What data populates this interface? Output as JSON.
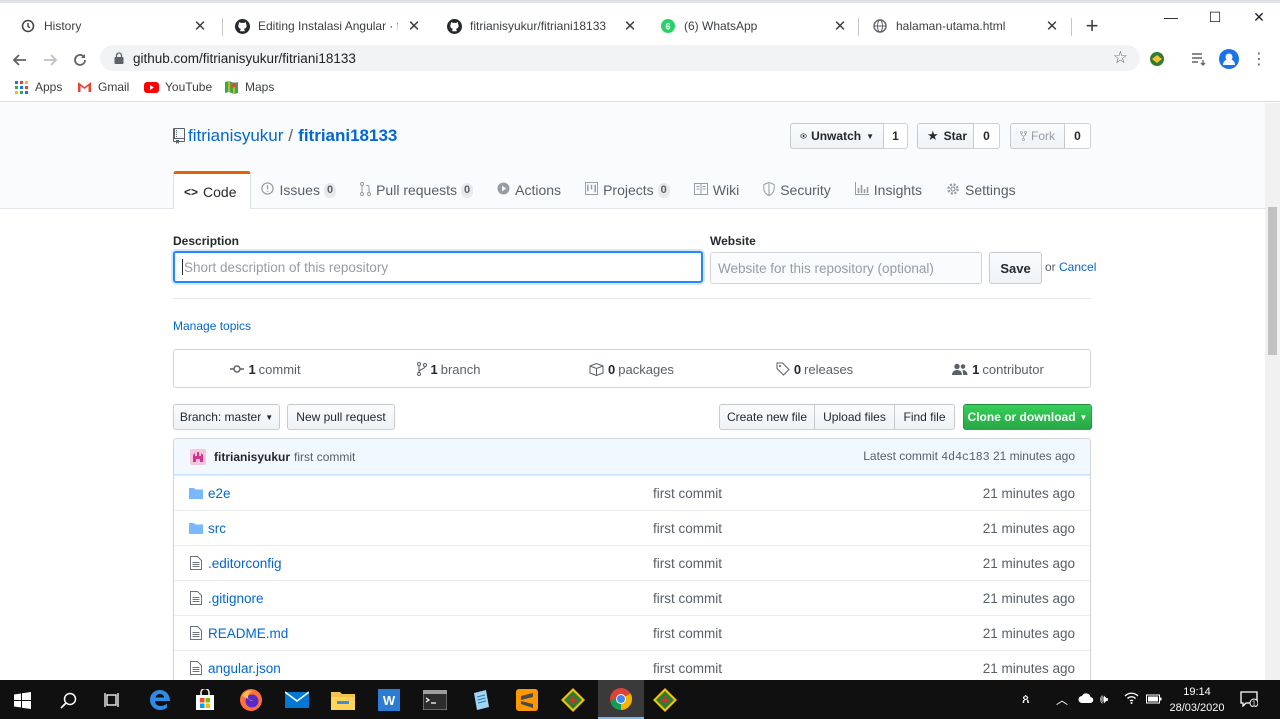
{
  "browser": {
    "tabs": [
      {
        "title": "History",
        "icon": "history-icon"
      },
      {
        "title": "Editing Instalasi Angular · fitria",
        "icon": "github-icon"
      },
      {
        "title": "fitrianisyukur/fitriani18133",
        "icon": "github-icon",
        "active": true
      },
      {
        "title": "(6) WhatsApp",
        "icon": "whatsapp-icon"
      },
      {
        "title": "halaman-utama.html",
        "icon": "globe-icon"
      }
    ],
    "url": "github.com/fitrianisyukur/fitriani18133",
    "bookmarks": [
      "Apps",
      "Gmail",
      "YouTube",
      "Maps"
    ]
  },
  "repo": {
    "owner": "fitrianisyukur",
    "separator": "/",
    "name": "fitriani18133",
    "watch_label": "Unwatch",
    "watch_count": "1",
    "star_label": "Star",
    "star_count": "0",
    "fork_label": "Fork",
    "fork_count": "0"
  },
  "nav": {
    "code": "Code",
    "issues": "Issues",
    "issues_count": "0",
    "pulls": "Pull requests",
    "pulls_count": "0",
    "actions": "Actions",
    "projects": "Projects",
    "projects_count": "0",
    "wiki": "Wiki",
    "security": "Security",
    "insights": "Insights",
    "settings": "Settings"
  },
  "about_form": {
    "description_label": "Description",
    "description_placeholder": "Short description of this repository",
    "website_label": "Website",
    "website_placeholder": "Website for this repository (optional)",
    "save": "Save",
    "or": "or",
    "cancel": "Cancel",
    "manage_topics": "Manage topics"
  },
  "summary": {
    "commits_num": "1",
    "commits_label": "commit",
    "branches_num": "1",
    "branches_label": "branch",
    "packages_num": "0",
    "packages_label": "packages",
    "releases_num": "0",
    "releases_label": "releases",
    "contributors_num": "1",
    "contributors_label": "contributor"
  },
  "actions": {
    "branch": "Branch: master",
    "new_pr": "New pull request",
    "create_file": "Create new file",
    "upload_files": "Upload files",
    "find_file": "Find file",
    "clone": "Clone or download"
  },
  "latest_commit": {
    "author": "fitrianisyukur",
    "message": "first commit",
    "prefix": "Latest commit",
    "sha": "4d4c183",
    "age": "21 minutes ago"
  },
  "files": [
    {
      "name": "e2e",
      "type": "dir",
      "message": "first commit",
      "age": "21 minutes ago"
    },
    {
      "name": "src",
      "type": "dir",
      "message": "first commit",
      "age": "21 minutes ago"
    },
    {
      "name": ".editorconfig",
      "type": "file",
      "message": "first commit",
      "age": "21 minutes ago"
    },
    {
      "name": ".gitignore",
      "type": "file",
      "message": "first commit",
      "age": "21 minutes ago"
    },
    {
      "name": "README.md",
      "type": "file",
      "message": "first commit",
      "age": "21 minutes ago"
    },
    {
      "name": "angular.json",
      "type": "file",
      "message": "first commit",
      "age": "21 minutes ago"
    }
  ],
  "taskbar": {
    "time": "19:14",
    "date": "28/03/2020",
    "notification_count": "1"
  },
  "colors": {
    "link": "#0366d6",
    "accent_orange": "#e36209",
    "green": "#28a745",
    "focus_blue": "#2188ff"
  }
}
